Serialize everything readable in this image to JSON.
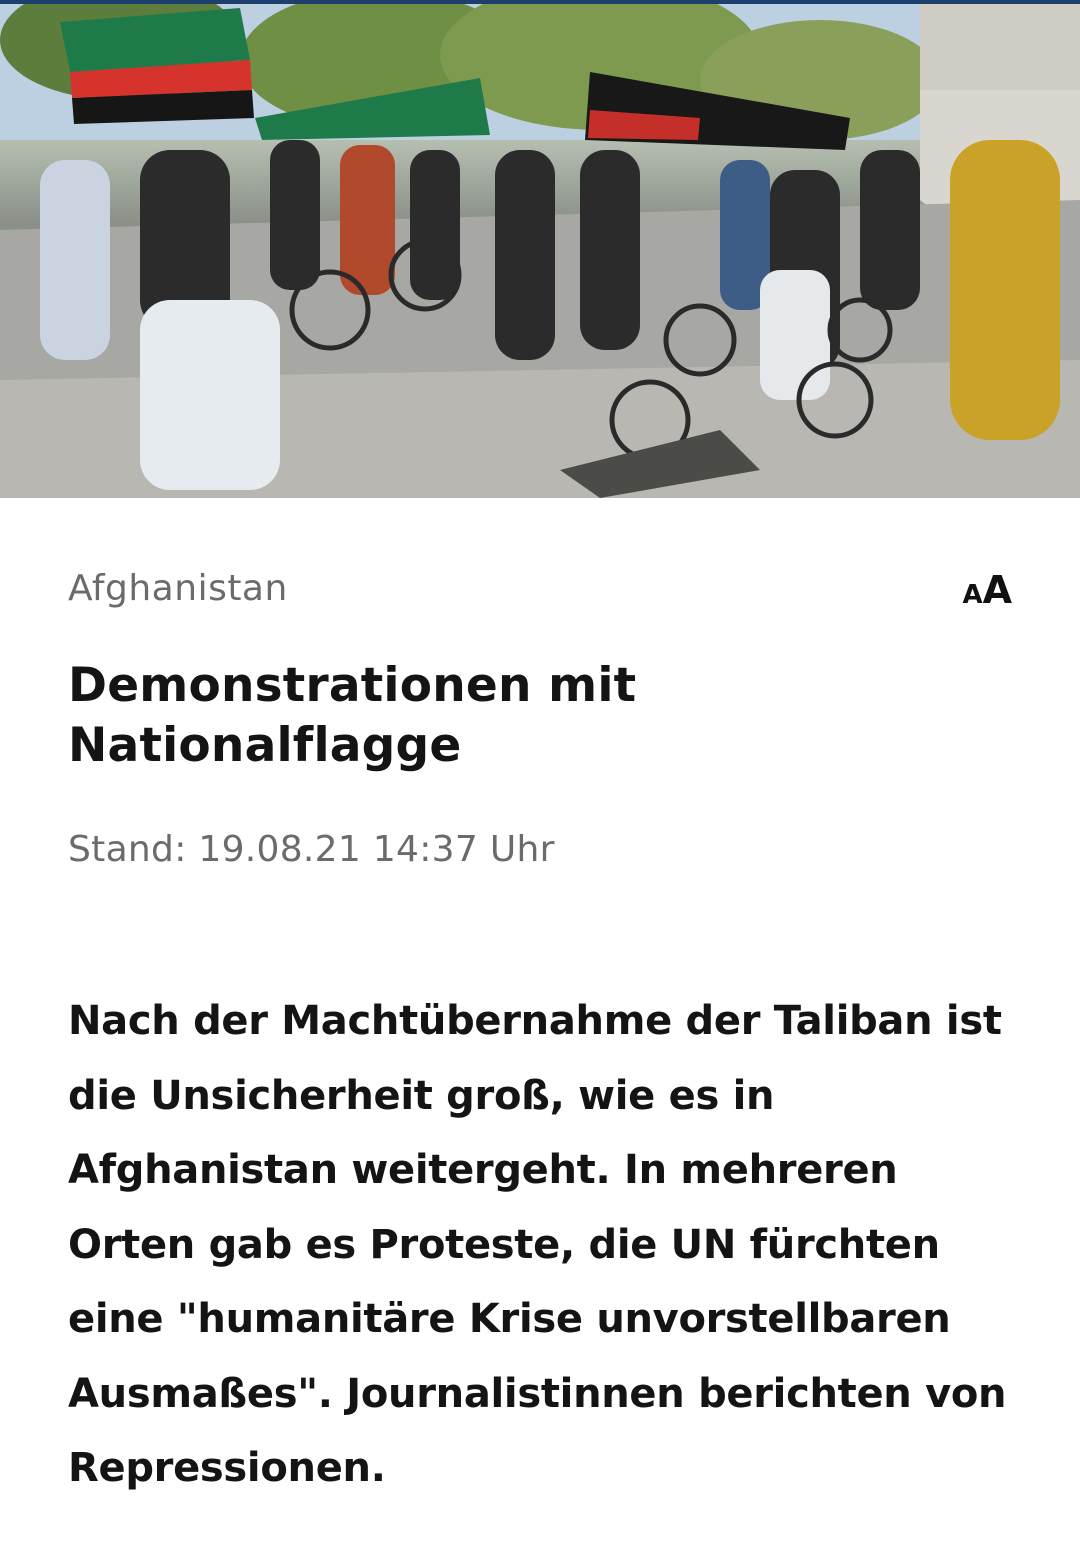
{
  "article": {
    "image": {
      "description_icon": "photo-demonstration"
    },
    "topic": "Afghanistan",
    "font_size_control": {
      "small": "A",
      "big": "A"
    },
    "headline": "Demonstrationen mit Nationalflagge",
    "date": "Stand: 19.08.21 14:37 Uhr",
    "lead": "Nach der Machtübernahme der Taliban ist die Unsicherheit groß, wie es in Afghanistan weitergeht. In mehreren Orten gab es Proteste, die UN fürchten eine \"humanitäre Krise unvorstellbaren Ausmaßes\". Journalistinnen berichten von Repressionen."
  },
  "colors": {
    "topic": "#6b6b6b",
    "headline": "#141414",
    "accent_topline": "#1d3f6e"
  }
}
